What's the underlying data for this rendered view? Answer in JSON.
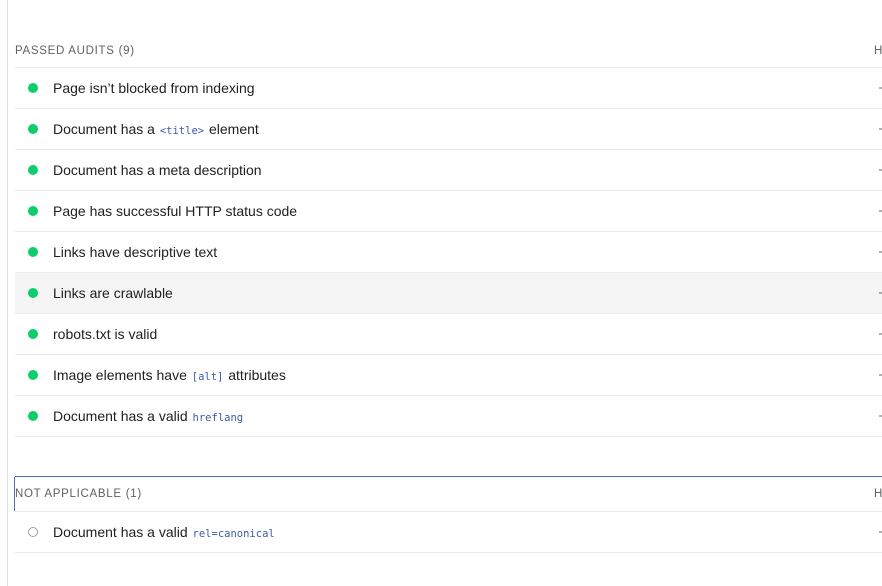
{
  "passed_group": {
    "label": "Passed audits",
    "count": "(9)",
    "toggle_label": "Hide",
    "audits": [
      {
        "segments": [
          {
            "text": "Page isn’t blocked from indexing"
          }
        ]
      },
      {
        "segments": [
          {
            "text": "Document has a "
          },
          {
            "code": "<title>"
          },
          {
            "text": " element"
          }
        ]
      },
      {
        "segments": [
          {
            "text": "Document has a meta description"
          }
        ]
      },
      {
        "segments": [
          {
            "text": "Page has successful HTTP status code"
          }
        ]
      },
      {
        "segments": [
          {
            "text": "Links have descriptive text"
          }
        ]
      },
      {
        "segments": [
          {
            "text": "Links are crawlable"
          }
        ]
      },
      {
        "segments": [
          {
            "text": "robots.txt is valid"
          }
        ]
      },
      {
        "segments": [
          {
            "text": "Image elements have "
          },
          {
            "code": "[alt]"
          },
          {
            "text": " attributes"
          }
        ]
      },
      {
        "segments": [
          {
            "text": "Document has a valid "
          },
          {
            "code": "hreflang"
          }
        ]
      }
    ],
    "status_color": "#0cce6b"
  },
  "not_applicable_group": {
    "label": "Not applicable",
    "count": "(1)",
    "toggle_label": "Hide",
    "audits": [
      {
        "segments": [
          {
            "text": "Document has a valid "
          },
          {
            "code": "rel=canonical"
          }
        ]
      }
    ],
    "status_color": "#9e9e9e"
  },
  "colors": {
    "pass": "#0cce6b",
    "code": "#3c5ba9",
    "divider": "#ebebeb",
    "hover_row": "#f5f5f5"
  }
}
